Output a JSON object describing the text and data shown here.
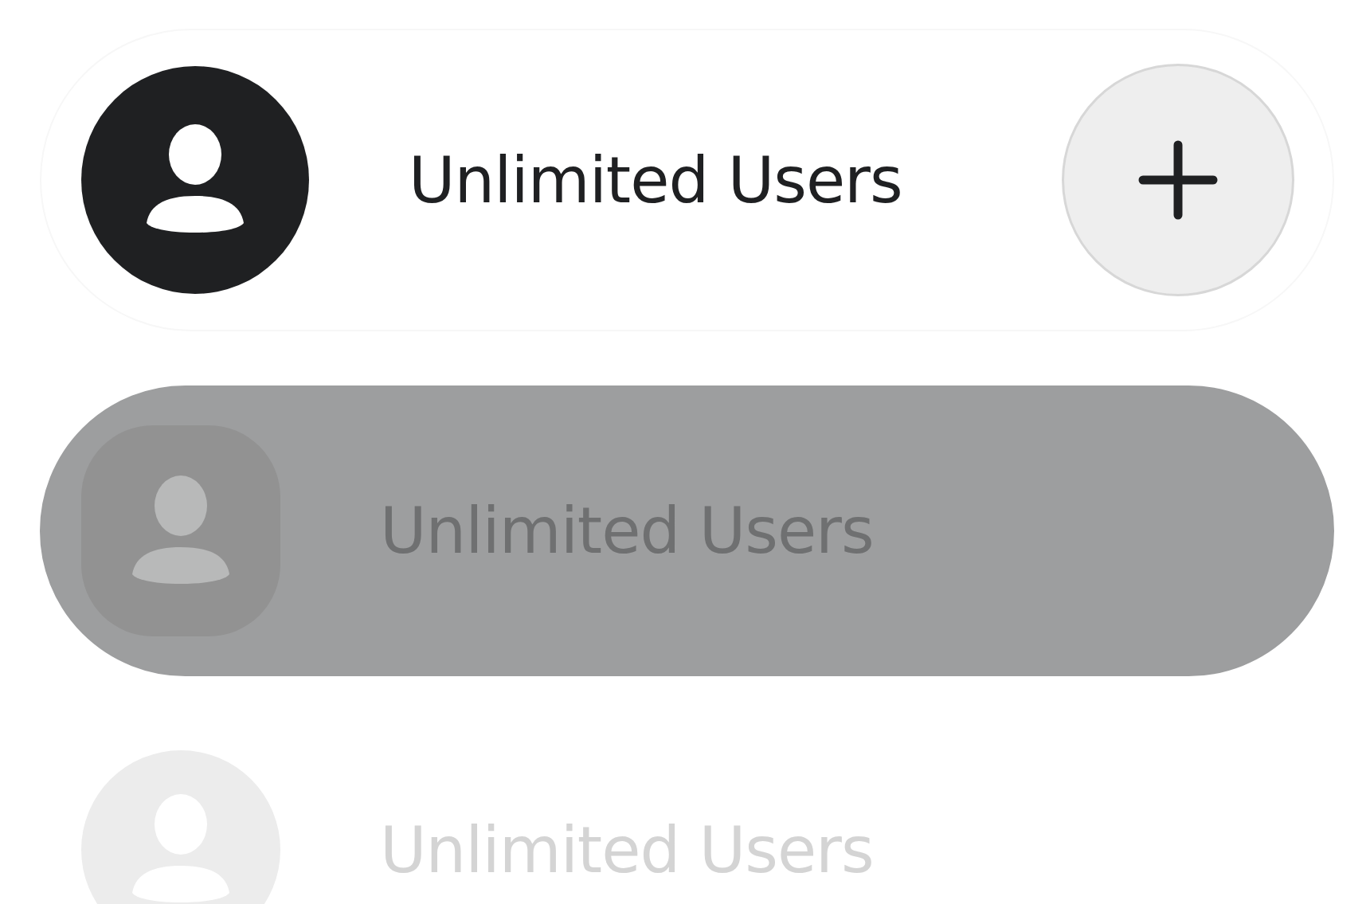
{
  "rows": [
    {
      "kind": "active",
      "label": "Unlimited Users",
      "add_button": true
    },
    {
      "kind": "disabled",
      "label": "Unlimited Users",
      "add_button": false
    },
    {
      "kind": "faded",
      "label": "Unlimited Users",
      "add_button": false
    }
  ]
}
